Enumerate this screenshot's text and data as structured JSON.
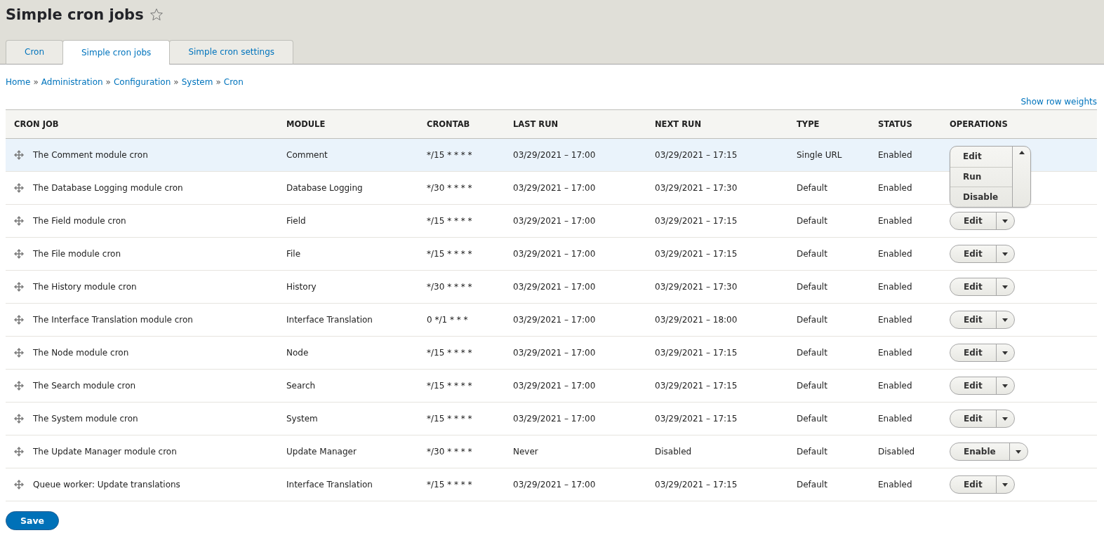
{
  "page_title": "Simple cron jobs",
  "favorite": false,
  "tabs": [
    {
      "label": "Cron",
      "selected": false
    },
    {
      "label": "Simple cron jobs",
      "selected": true
    },
    {
      "label": "Simple cron settings",
      "selected": false
    }
  ],
  "breadcrumb": {
    "separator": "»",
    "items": [
      "Home",
      "Administration",
      "Configuration",
      "System",
      "Cron"
    ]
  },
  "show_row_weights": "Show row weights",
  "table": {
    "columns": [
      "CRON JOB",
      "MODULE",
      "CRONTAB",
      "LAST RUN",
      "NEXT RUN",
      "TYPE",
      "STATUS",
      "OPERATIONS"
    ],
    "rows": [
      {
        "job": "The Comment module cron",
        "module": "Comment",
        "crontab": "*/15 * * * *",
        "last_run": "03/29/2021 – 17:00",
        "next_run": "03/29/2021 – 17:15",
        "type": "Single URL",
        "status": "Enabled",
        "highlighted": true,
        "operation": {
          "label": "Edit",
          "expanded": true,
          "menu": [
            "Run",
            "Disable"
          ]
        }
      },
      {
        "job": "The Database Logging module cron",
        "module": "Database Logging",
        "crontab": "*/30 * * * *",
        "last_run": "03/29/2021 – 17:00",
        "next_run": "03/29/2021 – 17:30",
        "type": "Default",
        "status": "Enabled",
        "highlighted": false
      },
      {
        "job": "The Field module cron",
        "module": "Field",
        "crontab": "*/15 * * * *",
        "last_run": "03/29/2021 – 17:00",
        "next_run": "03/29/2021 – 17:15",
        "type": "Default",
        "status": "Enabled",
        "highlighted": false,
        "operation": {
          "label": "Edit",
          "expanded": false
        }
      },
      {
        "job": "The File module cron",
        "module": "File",
        "crontab": "*/15 * * * *",
        "last_run": "03/29/2021 – 17:00",
        "next_run": "03/29/2021 – 17:15",
        "type": "Default",
        "status": "Enabled",
        "highlighted": false,
        "operation": {
          "label": "Edit",
          "expanded": false
        }
      },
      {
        "job": "The History module cron",
        "module": "History",
        "crontab": "*/30 * * * *",
        "last_run": "03/29/2021 – 17:00",
        "next_run": "03/29/2021 – 17:30",
        "type": "Default",
        "status": "Enabled",
        "highlighted": false,
        "operation": {
          "label": "Edit",
          "expanded": false
        }
      },
      {
        "job": "The Interface Translation module cron",
        "module": "Interface Translation",
        "crontab": "0 */1 * * *",
        "last_run": "03/29/2021 – 17:00",
        "next_run": "03/29/2021 – 18:00",
        "type": "Default",
        "status": "Enabled",
        "highlighted": false,
        "operation": {
          "label": "Edit",
          "expanded": false
        }
      },
      {
        "job": "The Node module cron",
        "module": "Node",
        "crontab": "*/15 * * * *",
        "last_run": "03/29/2021 – 17:00",
        "next_run": "03/29/2021 – 17:15",
        "type": "Default",
        "status": "Enabled",
        "highlighted": false,
        "operation": {
          "label": "Edit",
          "expanded": false
        }
      },
      {
        "job": "The Search module cron",
        "module": "Search",
        "crontab": "*/15 * * * *",
        "last_run": "03/29/2021 – 17:00",
        "next_run": "03/29/2021 – 17:15",
        "type": "Default",
        "status": "Enabled",
        "highlighted": false,
        "operation": {
          "label": "Edit",
          "expanded": false
        }
      },
      {
        "job": "The System module cron",
        "module": "System",
        "crontab": "*/15 * * * *",
        "last_run": "03/29/2021 – 17:00",
        "next_run": "03/29/2021 – 17:15",
        "type": "Default",
        "status": "Enabled",
        "highlighted": false,
        "operation": {
          "label": "Edit",
          "expanded": false
        }
      },
      {
        "job": "The Update Manager module cron",
        "module": "Update Manager",
        "crontab": "*/30 * * * *",
        "last_run": "Never",
        "next_run": "Disabled",
        "type": "Default",
        "status": "Disabled",
        "highlighted": false,
        "operation": {
          "label": "Enable",
          "expanded": false
        }
      },
      {
        "job": "Queue worker: Update translations",
        "module": "Interface Translation",
        "crontab": "*/15 * * * *",
        "last_run": "03/29/2021 – 17:00",
        "next_run": "03/29/2021 – 17:15",
        "type": "Default",
        "status": "Enabled",
        "highlighted": false,
        "operation": {
          "label": "Edit",
          "expanded": false
        }
      }
    ]
  },
  "save_button": "Save"
}
